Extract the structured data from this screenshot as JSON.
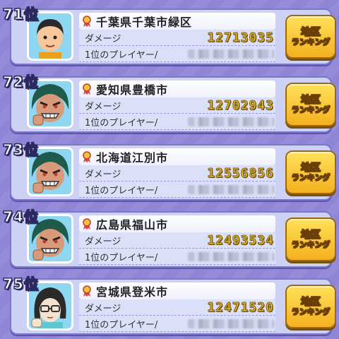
{
  "rows": [
    {
      "rank": "71位",
      "city": "千葉県千葉市緑区",
      "damage_label": "ダメージ",
      "damage": "12713035",
      "first_label": "1位のプレイヤー/",
      "avatar": "boy",
      "button_line1": "地区",
      "button_line2": "ランキング"
    },
    {
      "rank": "72位",
      "city": "愛知県豊橋市",
      "damage_label": "ダメージ",
      "damage": "12702943",
      "first_label": "1位のプレイヤー/",
      "avatar": "villain",
      "button_line1": "地区",
      "button_line2": "ランキング"
    },
    {
      "rank": "73位",
      "city": "北海道江別市",
      "damage_label": "ダメージ",
      "damage": "12556856",
      "first_label": "1位のプレイヤー/",
      "avatar": "villain",
      "button_line1": "地区",
      "button_line2": "ランキング"
    },
    {
      "rank": "74位",
      "city": "広島県福山市",
      "damage_label": "ダメージ",
      "damage": "12493534",
      "first_label": "1位のプレイヤー/",
      "avatar": "villain",
      "button_line1": "地区",
      "button_line2": "ランキング"
    },
    {
      "rank": "75位",
      "city": "宮城県登米市",
      "damage_label": "ダメージ",
      "damage": "12471520",
      "first_label": "1位のプレイヤー/",
      "avatar": "glasses-girl",
      "button_line1": "地区",
      "button_line2": "ランキング"
    }
  ],
  "colors": {
    "background": "#8f84d6",
    "card": "#cdd1f4",
    "damage": "#e8c420",
    "button": "#f4b020"
  }
}
